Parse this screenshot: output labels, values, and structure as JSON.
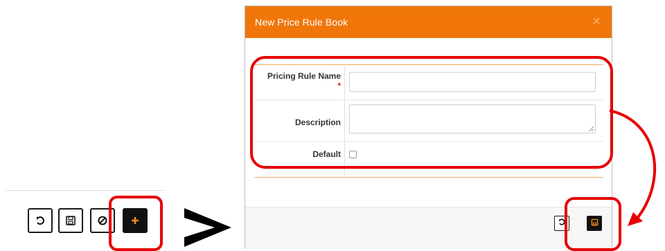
{
  "modal": {
    "title": "New Price Rule Book",
    "close_glyph": "×"
  },
  "form": {
    "pricing_rule_name_label": "Pricing Rule Name",
    "required_marker": "*",
    "pricing_rule_name_value": "",
    "description_label": "Description",
    "description_value": "",
    "default_label": "Default",
    "default_checked": false
  },
  "toolbar_icons": [
    "undo-icon",
    "save-icon",
    "cancel-icon",
    "add-icon"
  ],
  "footer_icons": [
    "undo-icon",
    "save-icon"
  ],
  "colors": {
    "header": "#f0760a",
    "annotation": "#e60000",
    "add_icon": "#f08a1c"
  },
  "annotation_symbol": ">"
}
